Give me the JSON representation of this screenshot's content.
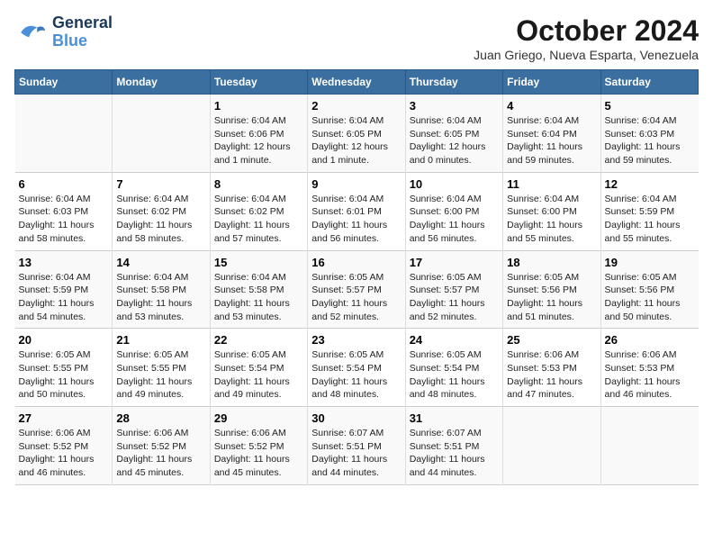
{
  "header": {
    "logo_line1": "General",
    "logo_line2": "Blue",
    "title": "October 2024",
    "subtitle": "Juan Griego, Nueva Esparta, Venezuela"
  },
  "columns": [
    "Sunday",
    "Monday",
    "Tuesday",
    "Wednesday",
    "Thursday",
    "Friday",
    "Saturday"
  ],
  "weeks": [
    [
      {
        "day": "",
        "info": ""
      },
      {
        "day": "",
        "info": ""
      },
      {
        "day": "1",
        "info": "Sunrise: 6:04 AM\nSunset: 6:06 PM\nDaylight: 12 hours\nand 1 minute."
      },
      {
        "day": "2",
        "info": "Sunrise: 6:04 AM\nSunset: 6:05 PM\nDaylight: 12 hours\nand 1 minute."
      },
      {
        "day": "3",
        "info": "Sunrise: 6:04 AM\nSunset: 6:05 PM\nDaylight: 12 hours\nand 0 minutes."
      },
      {
        "day": "4",
        "info": "Sunrise: 6:04 AM\nSunset: 6:04 PM\nDaylight: 11 hours\nand 59 minutes."
      },
      {
        "day": "5",
        "info": "Sunrise: 6:04 AM\nSunset: 6:03 PM\nDaylight: 11 hours\nand 59 minutes."
      }
    ],
    [
      {
        "day": "6",
        "info": "Sunrise: 6:04 AM\nSunset: 6:03 PM\nDaylight: 11 hours\nand 58 minutes."
      },
      {
        "day": "7",
        "info": "Sunrise: 6:04 AM\nSunset: 6:02 PM\nDaylight: 11 hours\nand 58 minutes."
      },
      {
        "day": "8",
        "info": "Sunrise: 6:04 AM\nSunset: 6:02 PM\nDaylight: 11 hours\nand 57 minutes."
      },
      {
        "day": "9",
        "info": "Sunrise: 6:04 AM\nSunset: 6:01 PM\nDaylight: 11 hours\nand 56 minutes."
      },
      {
        "day": "10",
        "info": "Sunrise: 6:04 AM\nSunset: 6:00 PM\nDaylight: 11 hours\nand 56 minutes."
      },
      {
        "day": "11",
        "info": "Sunrise: 6:04 AM\nSunset: 6:00 PM\nDaylight: 11 hours\nand 55 minutes."
      },
      {
        "day": "12",
        "info": "Sunrise: 6:04 AM\nSunset: 5:59 PM\nDaylight: 11 hours\nand 55 minutes."
      }
    ],
    [
      {
        "day": "13",
        "info": "Sunrise: 6:04 AM\nSunset: 5:59 PM\nDaylight: 11 hours\nand 54 minutes."
      },
      {
        "day": "14",
        "info": "Sunrise: 6:04 AM\nSunset: 5:58 PM\nDaylight: 11 hours\nand 53 minutes."
      },
      {
        "day": "15",
        "info": "Sunrise: 6:04 AM\nSunset: 5:58 PM\nDaylight: 11 hours\nand 53 minutes."
      },
      {
        "day": "16",
        "info": "Sunrise: 6:05 AM\nSunset: 5:57 PM\nDaylight: 11 hours\nand 52 minutes."
      },
      {
        "day": "17",
        "info": "Sunrise: 6:05 AM\nSunset: 5:57 PM\nDaylight: 11 hours\nand 52 minutes."
      },
      {
        "day": "18",
        "info": "Sunrise: 6:05 AM\nSunset: 5:56 PM\nDaylight: 11 hours\nand 51 minutes."
      },
      {
        "day": "19",
        "info": "Sunrise: 6:05 AM\nSunset: 5:56 PM\nDaylight: 11 hours\nand 50 minutes."
      }
    ],
    [
      {
        "day": "20",
        "info": "Sunrise: 6:05 AM\nSunset: 5:55 PM\nDaylight: 11 hours\nand 50 minutes."
      },
      {
        "day": "21",
        "info": "Sunrise: 6:05 AM\nSunset: 5:55 PM\nDaylight: 11 hours\nand 49 minutes."
      },
      {
        "day": "22",
        "info": "Sunrise: 6:05 AM\nSunset: 5:54 PM\nDaylight: 11 hours\nand 49 minutes."
      },
      {
        "day": "23",
        "info": "Sunrise: 6:05 AM\nSunset: 5:54 PM\nDaylight: 11 hours\nand 48 minutes."
      },
      {
        "day": "24",
        "info": "Sunrise: 6:05 AM\nSunset: 5:54 PM\nDaylight: 11 hours\nand 48 minutes."
      },
      {
        "day": "25",
        "info": "Sunrise: 6:06 AM\nSunset: 5:53 PM\nDaylight: 11 hours\nand 47 minutes."
      },
      {
        "day": "26",
        "info": "Sunrise: 6:06 AM\nSunset: 5:53 PM\nDaylight: 11 hours\nand 46 minutes."
      }
    ],
    [
      {
        "day": "27",
        "info": "Sunrise: 6:06 AM\nSunset: 5:52 PM\nDaylight: 11 hours\nand 46 minutes."
      },
      {
        "day": "28",
        "info": "Sunrise: 6:06 AM\nSunset: 5:52 PM\nDaylight: 11 hours\nand 45 minutes."
      },
      {
        "day": "29",
        "info": "Sunrise: 6:06 AM\nSunset: 5:52 PM\nDaylight: 11 hours\nand 45 minutes."
      },
      {
        "day": "30",
        "info": "Sunrise: 6:07 AM\nSunset: 5:51 PM\nDaylight: 11 hours\nand 44 minutes."
      },
      {
        "day": "31",
        "info": "Sunrise: 6:07 AM\nSunset: 5:51 PM\nDaylight: 11 hours\nand 44 minutes."
      },
      {
        "day": "",
        "info": ""
      },
      {
        "day": "",
        "info": ""
      }
    ]
  ]
}
